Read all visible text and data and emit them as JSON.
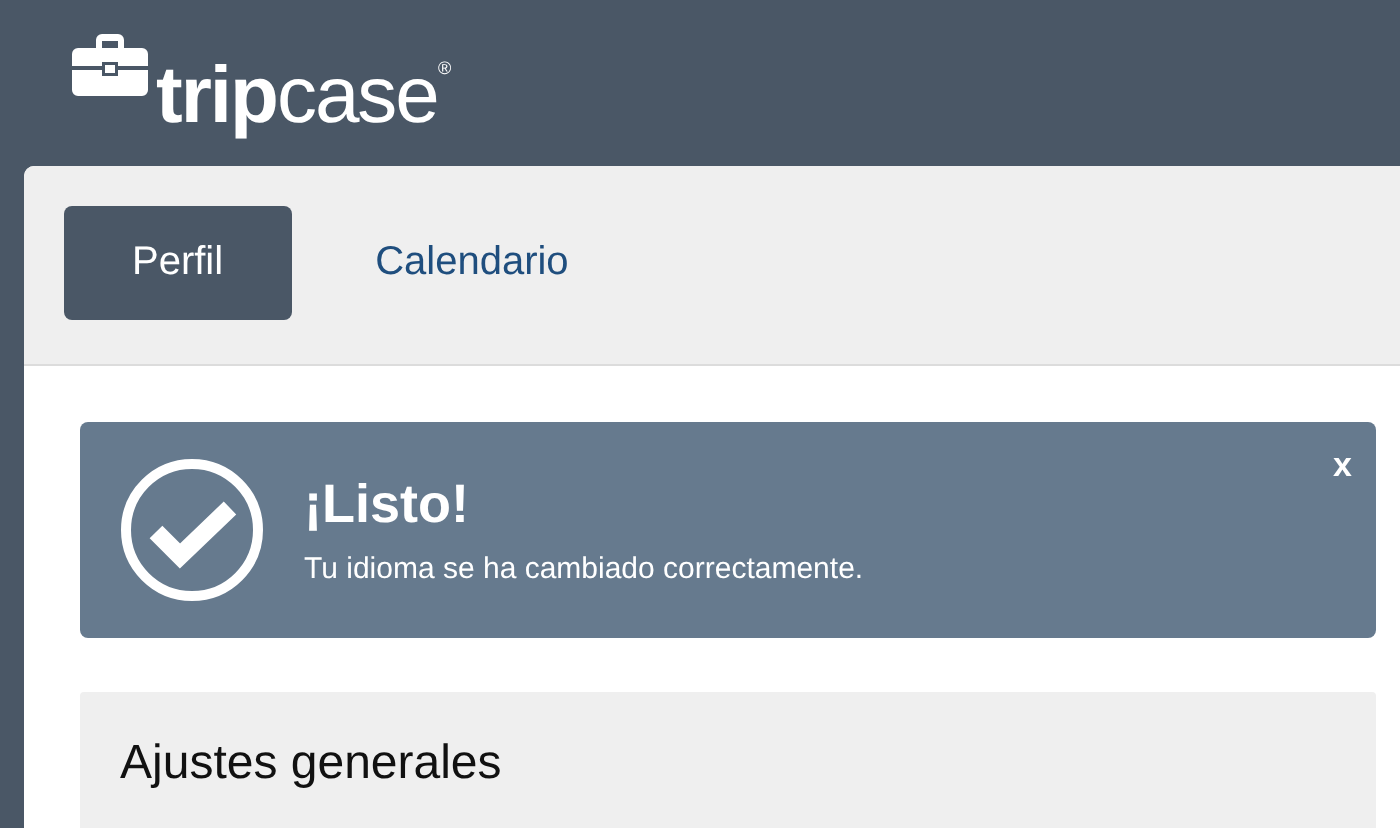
{
  "header": {
    "logo": "**trip**case$^{®}$"
  },
  "tabs": [
    {
      "label": "Perfil",
      "selected": true
    },
    {
      "label": "Calendario",
      "selected": false
    }
  ],
  "alert": {
    "kind": "success",
    "title": "¡Listo!",
    "message": "Tu idioma se ha cambiado correctamente.",
    "close": "x"
  },
  "section": {
    "title": "Ajustes generales"
  }
}
